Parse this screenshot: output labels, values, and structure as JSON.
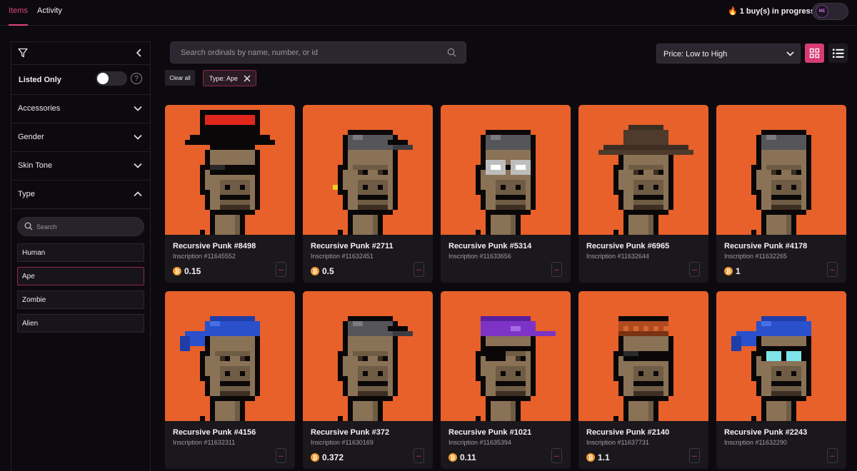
{
  "nav": {
    "tabs": [
      "Items",
      "Activity"
    ],
    "progress_text": "1 buy(s) in progress...",
    "wallet_label": "ME"
  },
  "sidebar": {
    "listed_only_label": "Listed Only",
    "listed_only_enabled": false,
    "help_label": "?",
    "filters": [
      "Accessories",
      "Gender",
      "Skin Tone",
      "Type"
    ],
    "type_search_placeholder": "Search",
    "type_options": [
      "Human",
      "Ape",
      "Zombie",
      "Alien"
    ],
    "type_selected": "Ape"
  },
  "search": {
    "placeholder": "Search ordinals by name, number, or id"
  },
  "sort": {
    "selected": "Price: Low to High"
  },
  "filters_bar": {
    "clear_all": "Clear all",
    "chip": "Type: Ape"
  },
  "colors": {
    "accent": "#e0457b",
    "card_bg": "#e8602a",
    "btc": "#f29a2e"
  },
  "items": [
    {
      "name": "Recursive Punk #8498",
      "inscription": "Inscription #11645552",
      "price": "0.15",
      "hat": "tophat",
      "eyes": "shades"
    },
    {
      "name": "Recursive Punk #2711",
      "inscription": "Inscription #11632451",
      "price": "0.5",
      "hat": "cap-gray",
      "eyes": "none",
      "earring": true
    },
    {
      "name": "Recursive Punk #5314",
      "inscription": "Inscription #11633656",
      "price": "",
      "hat": "beanie-gray",
      "eyes": "goggles"
    },
    {
      "name": "Recursive Punk #6965",
      "inscription": "Inscription #11632644",
      "price": "",
      "hat": "cowboy",
      "eyes": "none"
    },
    {
      "name": "Recursive Punk #4178",
      "inscription": "Inscription #11632265",
      "price": "1",
      "hat": "beanie-gray",
      "eyes": "none"
    },
    {
      "name": "Recursive Punk #4156",
      "inscription": "Inscription #11632311",
      "price": "",
      "hat": "bandana",
      "eyes": "none"
    },
    {
      "name": "Recursive Punk #372",
      "inscription": "Inscription #11630169",
      "price": "0.372",
      "hat": "cap-gray",
      "eyes": "none"
    },
    {
      "name": "Recursive Punk #1021",
      "inscription": "Inscription #11635394",
      "price": "0.11",
      "hat": "cap-purple",
      "eyes": "patch"
    },
    {
      "name": "Recursive Punk #2140",
      "inscription": "Inscription #11637731",
      "price": "1.1",
      "hat": "knit-orange",
      "eyes": "shades"
    },
    {
      "name": "Recursive Punk #2243",
      "inscription": "Inscription #11632290",
      "price": "",
      "hat": "bandana",
      "eyes": "cyan-glasses"
    }
  ],
  "more_label": "..."
}
